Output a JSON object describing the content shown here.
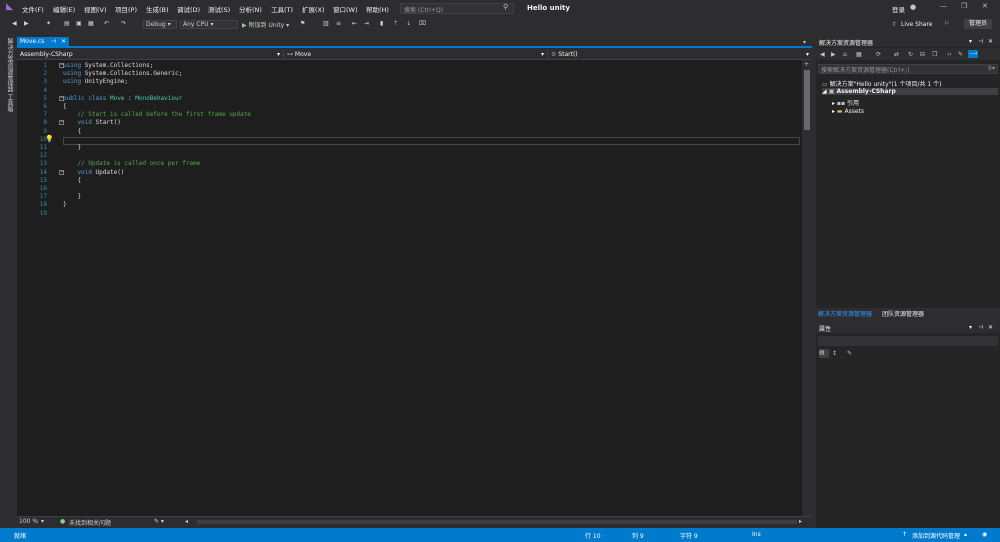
{
  "menu": [
    "文件(F)",
    "编辑(E)",
    "视图(V)",
    "项目(P)",
    "生成(B)",
    "调试(D)",
    "测试(S)",
    "分析(N)",
    "工具(T)",
    "扩展(X)",
    "窗口(W)",
    "帮助(H)"
  ],
  "search": {
    "placeholder": "搜索 (Ctrl+Q)"
  },
  "window_title": "Hello unity",
  "account": {
    "signin": "登录",
    "liveshare": "Live Share",
    "admin": "管理员"
  },
  "toolbar": {
    "config": "Debug",
    "platform": "Any CPU",
    "attach": "附加到 Unity"
  },
  "left_strip": {
    "solution_explorer": "解决方案资源管理器",
    "toolbox": "工具箱"
  },
  "tab": {
    "name": "Move.cs"
  },
  "nav": {
    "project": "Assembly-CSharp",
    "class": "Move",
    "member": "Start()"
  },
  "code_lines": [
    {
      "n": "1",
      "parts": [
        [
          "kw",
          "using "
        ],
        [
          "",
          "System.Collections;"
        ]
      ]
    },
    {
      "n": "2",
      "parts": [
        [
          "kw",
          "using "
        ],
        [
          "",
          "System.Collections.Generic;"
        ]
      ]
    },
    {
      "n": "3",
      "parts": [
        [
          "kw",
          "using "
        ],
        [
          "",
          "UnityEngine;"
        ]
      ]
    },
    {
      "n": "4",
      "parts": []
    },
    {
      "n": "5",
      "parts": [
        [
          "kw",
          "public class "
        ],
        [
          "ty",
          "Move"
        ],
        [
          "",
          " : "
        ],
        [
          "ty",
          "MonoBehaviour"
        ]
      ]
    },
    {
      "n": "6",
      "parts": [
        [
          "",
          "{"
        ]
      ]
    },
    {
      "n": "7",
      "parts": [
        [
          "cm",
          "    // Start is called before the first frame update"
        ]
      ]
    },
    {
      "n": "8",
      "parts": [
        [
          "kw",
          "    void "
        ],
        [
          "",
          "Start()"
        ]
      ]
    },
    {
      "n": "9",
      "parts": [
        [
          "",
          "    {"
        ]
      ]
    },
    {
      "n": "10",
      "parts": []
    },
    {
      "n": "11",
      "parts": [
        [
          "",
          "    }"
        ]
      ]
    },
    {
      "n": "12",
      "parts": []
    },
    {
      "n": "13",
      "parts": [
        [
          "cm",
          "    // Update is called once per frame"
        ]
      ]
    },
    {
      "n": "14",
      "parts": [
        [
          "kw",
          "    void "
        ],
        [
          "",
          "Update()"
        ]
      ]
    },
    {
      "n": "15",
      "parts": [
        [
          "",
          "    {"
        ]
      ]
    },
    {
      "n": "16",
      "parts": []
    },
    {
      "n": "17",
      "parts": [
        [
          "",
          "    }"
        ]
      ]
    },
    {
      "n": "18",
      "parts": [
        [
          "",
          "}"
        ]
      ]
    },
    {
      "n": "19",
      "parts": []
    }
  ],
  "editor_status": {
    "zoom": "100 %",
    "issues": "未找到相关问题"
  },
  "solution_explorer": {
    "title": "解决方案资源管理器",
    "search_placeholder": "搜索解决方案资源管理器(Ctrl+;)",
    "solution": "解决方案\"Hello unity\"(1 个项目/共 1 个)",
    "project": "Assembly-CSharp",
    "refs": "引用",
    "assets": "Assets"
  },
  "bottom_tabs": {
    "solution": "解决方案资源管理器",
    "team": "团队资源管理器"
  },
  "properties": {
    "title": "属性"
  },
  "statusbar": {
    "ready": "就绪",
    "line": "行 10",
    "col": "列 9",
    "char": "字符 9",
    "ins": "Ins",
    "source_control": "添加到源代码管理"
  },
  "colors": {
    "accent": "#007acc",
    "editor_bg": "#1e1e1e",
    "chrome": "#2d2d30"
  }
}
